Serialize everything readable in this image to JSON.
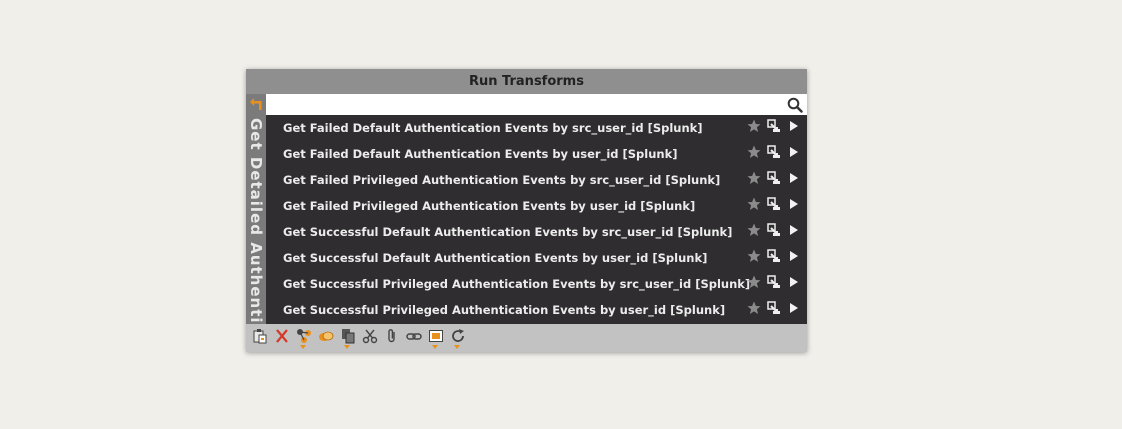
{
  "panel": {
    "title": "Run Transforms",
    "side_label": "Get Detailed Authentic",
    "search": {
      "value": "",
      "placeholder": ""
    }
  },
  "transforms": [
    {
      "label": "Get Failed Default Authentication Events by src_user_id [Splunk]"
    },
    {
      "label": "Get Failed Default Authentication Events by user_id [Splunk]"
    },
    {
      "label": "Get Failed Privileged Authentication Events by src_user_id [Splunk]"
    },
    {
      "label": "Get Failed Privileged Authentication Events by user_id [Splunk]"
    },
    {
      "label": "Get Successful Default Authentication Events by src_user_id [Splunk]"
    },
    {
      "label": "Get Successful Default Authentication Events by user_id [Splunk]"
    },
    {
      "label": "Get Successful Privileged Authentication Events by src_user_id [Splunk]"
    },
    {
      "label": "Get Successful Privileged Authentication Events by user_id [Splunk]"
    }
  ],
  "row_icons": [
    "star-icon",
    "run-transform-icon",
    "play-arrow-icon"
  ],
  "toolbar_icons": [
    "paste-icon",
    "delete-icon",
    "select-related-icon",
    "merge-icon",
    "copy-icon",
    "cut-icon",
    "attach-icon",
    "link-icon",
    "select-icon",
    "refresh-icon"
  ],
  "colors": {
    "accent": "#e8901d",
    "list_bg": "#2f2d2f",
    "title_bg": "#8f8f8f",
    "panel_bg": "#c2c2c2"
  }
}
